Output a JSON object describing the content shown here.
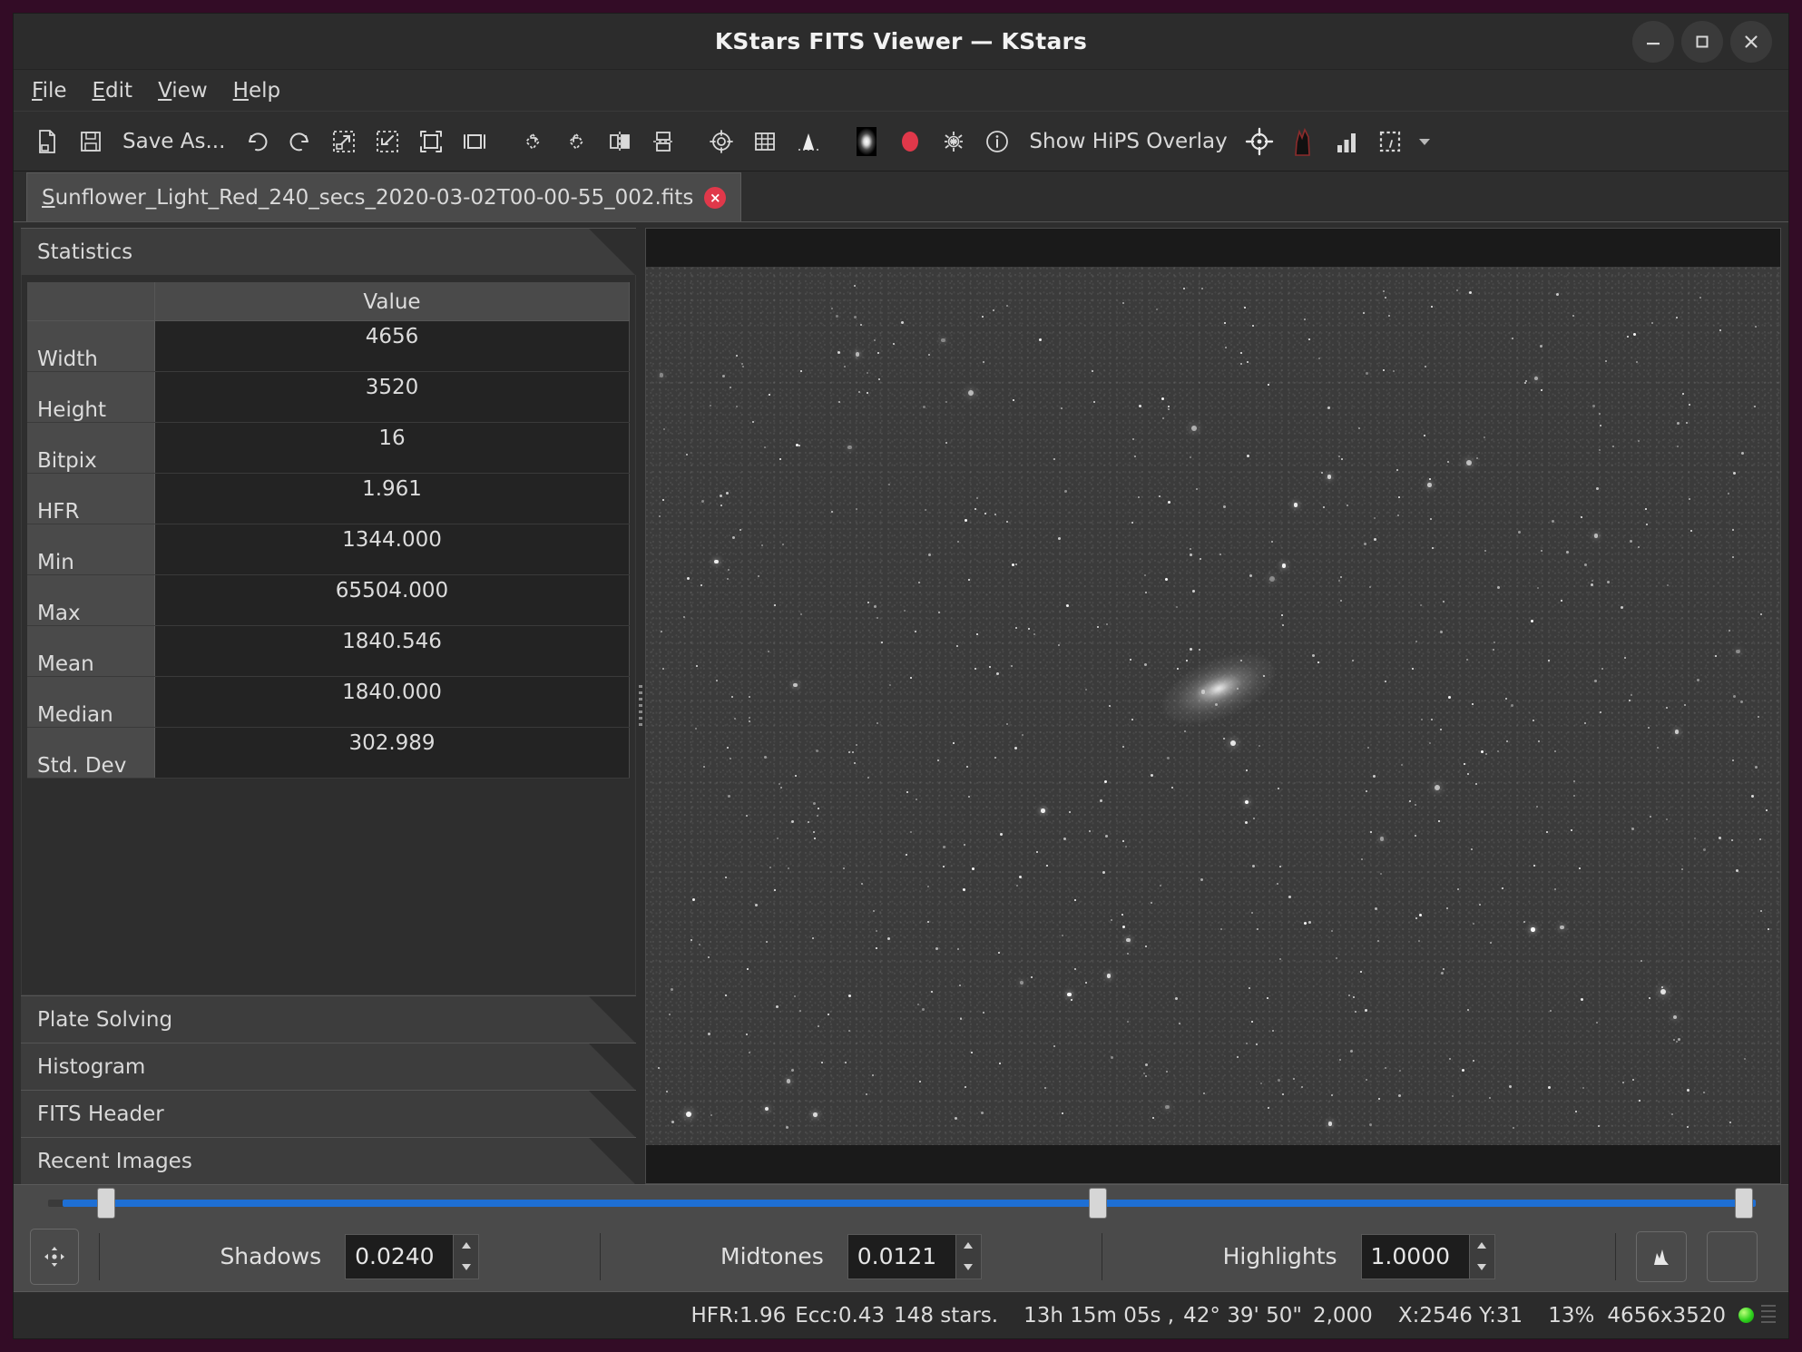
{
  "window": {
    "title": "KStars FITS Viewer — KStars",
    "minimize_label": "minimize",
    "maximize_label": "maximize",
    "close_label": "close"
  },
  "menubar": {
    "items": [
      {
        "label": "File",
        "accel": "F"
      },
      {
        "label": "Edit",
        "accel": "E"
      },
      {
        "label": "View",
        "accel": "V"
      },
      {
        "label": "Help",
        "accel": "H"
      }
    ]
  },
  "toolbar": {
    "save_as_label": "Save As...",
    "hips_overlay_label": "Show HiPS Overlay",
    "icons": [
      "open-file-icon",
      "save-icon",
      "undo-icon",
      "redo-icon",
      "zoom-in-icon",
      "zoom-out-icon",
      "zoom-default-icon",
      "zoom-fit-icon",
      "rotate-cw-icon",
      "rotate-ccw-icon",
      "flip-horizontal-icon",
      "flip-vertical-icon",
      "crosshair-icon",
      "grid-icon",
      "equatorial-grid-icon",
      "star-profile-icon",
      "auto-stretch-icon",
      "detect-stars-icon",
      "info-icon",
      "target-icon",
      "histogram-peak-icon",
      "statistics-icon",
      "selection-icon",
      "chevron-down-icon"
    ]
  },
  "tab": {
    "filename": "Sunflower_Light_Red_240_secs_2020-03-02T00-00-55_002.fits",
    "accel_letter": "S",
    "close_label": "×"
  },
  "sidebar": {
    "sections": [
      {
        "label": "Statistics",
        "expanded": true
      },
      {
        "label": "Plate Solving",
        "expanded": false
      },
      {
        "label": "Histogram",
        "expanded": false
      },
      {
        "label": "FITS Header",
        "expanded": false
      },
      {
        "label": "Recent Images",
        "expanded": false
      }
    ],
    "statistics": {
      "column_header": "Value",
      "rows": [
        {
          "name": "Width",
          "value": "4656"
        },
        {
          "name": "Height",
          "value": "3520"
        },
        {
          "name": "Bitpix",
          "value": "16"
        },
        {
          "name": "HFR",
          "value": "1.961"
        },
        {
          "name": "Min",
          "value": "1344.000"
        },
        {
          "name": "Max",
          "value": "65504.000"
        },
        {
          "name": "Mean",
          "value": "1840.546"
        },
        {
          "name": "Median",
          "value": "1840.000"
        },
        {
          "name": "Std. Dev",
          "value": "302.989"
        }
      ]
    }
  },
  "stretch": {
    "shadows_label": "Shadows",
    "shadows_value": "0.0240",
    "midtones_label": "Midtones",
    "midtones_value": "0.0121",
    "highlights_label": "Highlights",
    "highlights_value": "1.0000",
    "shadows_handle_pct": 3.0,
    "midtones_handle_pct": 61.5,
    "highlights_handle_pct": 99.6,
    "move_button_icon": "pan-move-icon",
    "histogram_button_icon": "histogram-icon",
    "blank_button_icon": "blank-button-icon"
  },
  "statusbar": {
    "hfr": "HFR:1.96",
    "ecc": "Ecc:0.43",
    "stars": "148 stars.",
    "ra": "13h 15m 05s ,",
    "dec": "42° 39' 50\"",
    "scale": "2,000",
    "cursor": "X:2546 Y:31",
    "zoom": "13%",
    "dimensions": "4656x3520",
    "led_color": "#2fd21e"
  },
  "colors": {
    "accent": "#1e6fd4",
    "close_badge": "#e0384a",
    "window_bg": "#2e2e2e",
    "panel_bg": "#4a4a4a",
    "table_value_bg": "#232323",
    "desktop_bg": "#330c26",
    "record_red": "#e0384a"
  }
}
